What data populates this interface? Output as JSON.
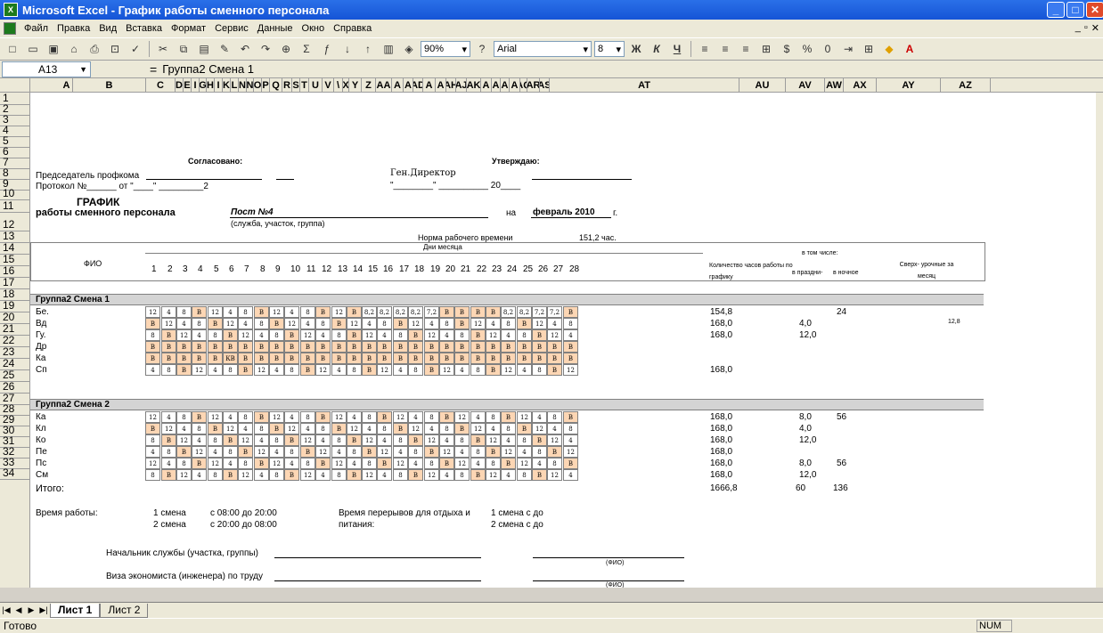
{
  "window": {
    "title": "Microsoft Excel - График работы сменного персонала"
  },
  "menu": [
    "Файл",
    "Правка",
    "Вид",
    "Вставка",
    "Формат",
    "Сервис",
    "Данные",
    "Окно",
    "Справка"
  ],
  "toolbar": {
    "zoom": "90%",
    "font": "Arial",
    "size": "8",
    "bold": "Ж",
    "italic": "К",
    "underline": "Ч"
  },
  "formula": {
    "cell": "A13",
    "content": "Группа2 Смена 1"
  },
  "columns": [
    "A",
    "B",
    "C",
    "D",
    "E",
    "I",
    "G",
    "H",
    "I",
    "K",
    "L",
    "N",
    "N",
    "O",
    "P",
    "Q",
    "R",
    "S",
    "T",
    "U",
    "V",
    "\\",
    "X",
    "Y",
    "Z",
    "AA",
    "A",
    "A",
    "AD",
    "A",
    "A",
    "AH",
    "AJ",
    "AK",
    "A",
    "A",
    "A",
    "A",
    "AQ",
    "AR",
    "AS",
    "AT",
    "AU",
    "AV",
    "AW",
    "AX",
    "AY",
    "AZ"
  ],
  "header": {
    "agreed": "Согласовано:",
    "approve": "Утверждаю:",
    "chairman": "Председатель профкома",
    "director": "Ген.Директор",
    "protocol": "Протокол №______ от \"____\" _________2",
    "date_line": "\"________\" __________ 20____",
    "title": "ГРАФИК",
    "subtitle": "работы  сменного персонала",
    "post": "Пост №4",
    "on": "на",
    "month": "февраль 2010",
    "g": "г.",
    "service": "(служба, участок, группа)",
    "norm_label": "Норма рабочего времени",
    "norm_value": "151,2 час."
  },
  "table": {
    "fio": "ФИО",
    "days_label": "Дни месяца",
    "days": [
      "1",
      "2",
      "3",
      "4",
      "5",
      "6",
      "7",
      "8",
      "9",
      "10",
      "11",
      "12",
      "13",
      "14",
      "15",
      "16",
      "17",
      "18",
      "19",
      "20",
      "21",
      "22",
      "23",
      "24",
      "25",
      "26",
      "27",
      "28"
    ],
    "hours_label": "Количество часов работы по графику",
    "incl_label": "в том числе:",
    "holiday": "в праздни-",
    "night": "в ночное",
    "overtime": "Сверх- урочные за месяц"
  },
  "groups": [
    "Группа2 Смена 1",
    "Группа2 Смена 2"
  ],
  "rows": [
    {
      "n": "14",
      "name": "Бе.",
      "d": [
        "12",
        "4",
        "8",
        "В",
        "12",
        "4",
        "8",
        "В",
        "12",
        "4",
        "8",
        "В",
        "12",
        "В",
        "8,2",
        "8,2",
        "8,2",
        "8,2",
        "7,2",
        "В",
        "В",
        "В",
        "В",
        "8,2",
        "8,2",
        "7,2",
        "7,2",
        "В"
      ],
      "h": "154,8",
      "hol": "",
      "night": "24",
      "ot": ""
    },
    {
      "n": "15",
      "name": "Вд",
      "d": [
        "В",
        "12",
        "4",
        "8",
        "В",
        "12",
        "4",
        "8",
        "В",
        "12",
        "4",
        "8",
        "В",
        "12",
        "4",
        "8",
        "В",
        "12",
        "4",
        "8",
        "В",
        "12",
        "4",
        "8",
        "В",
        "12",
        "4",
        "8"
      ],
      "h": "168,0",
      "hol": "4,0",
      "night": "",
      "ot": "12,8"
    },
    {
      "n": "16",
      "name": "Гу.",
      "d": [
        "8",
        "В",
        "12",
        "4",
        "8",
        "В",
        "12",
        "4",
        "8",
        "В",
        "12",
        "4",
        "8",
        "В",
        "12",
        "4",
        "8",
        "В",
        "12",
        "4",
        "8",
        "В",
        "12",
        "4",
        "8",
        "В",
        "12",
        "4"
      ],
      "h": "168,0",
      "hol": "12,0",
      "night": "",
      "ot": ""
    },
    {
      "n": "17",
      "name": "Др",
      "d": [
        "В",
        "В",
        "В",
        "В",
        "В",
        "В",
        "В",
        "В",
        "В",
        "В",
        "В",
        "В",
        "В",
        "В",
        "В",
        "В",
        "В",
        "В",
        "В",
        "В",
        "В",
        "В",
        "В",
        "В",
        "В",
        "В",
        "В",
        "В"
      ],
      "h": "",
      "hol": "",
      "night": "",
      "ot": ""
    },
    {
      "n": "18",
      "name": "Ка",
      "d": [
        "В",
        "В",
        "В",
        "В",
        "В",
        "КВ",
        "В",
        "В",
        "В",
        "В",
        "В",
        "В",
        "В",
        "В",
        "В",
        "В",
        "В",
        "В",
        "В",
        "В",
        "В",
        "В",
        "В",
        "В",
        "В",
        "В",
        "В",
        "В"
      ],
      "h": "",
      "hol": "",
      "night": "",
      "ot": ""
    },
    {
      "n": "19",
      "name": "Сп",
      "d": [
        "4",
        "8",
        "В",
        "12",
        "4",
        "8",
        "В",
        "12",
        "4",
        "8",
        "В",
        "12",
        "4",
        "8",
        "В",
        "12",
        "4",
        "8",
        "В",
        "12",
        "4",
        "8",
        "В",
        "12",
        "4",
        "8",
        "В",
        "12"
      ],
      "h": "168,0",
      "hol": "",
      "night": "",
      "ot": ""
    },
    {
      "n": "21",
      "name": "Ка",
      "d": [
        "12",
        "4",
        "8",
        "В",
        "12",
        "4",
        "8",
        "В",
        "12",
        "4",
        "8",
        "В",
        "12",
        "4",
        "8",
        "В",
        "12",
        "4",
        "8",
        "В",
        "12",
        "4",
        "8",
        "В",
        "12",
        "4",
        "8",
        "В"
      ],
      "h": "168,0",
      "hol": "8,0",
      "night": "56",
      "ot": ""
    },
    {
      "n": "22",
      "name": "Кл",
      "d": [
        "В",
        "12",
        "4",
        "8",
        "В",
        "12",
        "4",
        "8",
        "В",
        "12",
        "4",
        "8",
        "В",
        "12",
        "4",
        "8",
        "В",
        "12",
        "4",
        "8",
        "В",
        "12",
        "4",
        "8",
        "В",
        "12",
        "4",
        "8"
      ],
      "h": "168,0",
      "hol": "4,0",
      "night": "",
      "ot": ""
    },
    {
      "n": "23",
      "name": "Ко",
      "d": [
        "8",
        "В",
        "12",
        "4",
        "8",
        "В",
        "12",
        "4",
        "8",
        "В",
        "12",
        "4",
        "8",
        "В",
        "12",
        "4",
        "8",
        "В",
        "12",
        "4",
        "8",
        "В",
        "12",
        "4",
        "8",
        "В",
        "12",
        "4"
      ],
      "h": "168,0",
      "hol": "12,0",
      "night": "",
      "ot": ""
    },
    {
      "n": "24",
      "name": "Пе",
      "d": [
        "4",
        "8",
        "В",
        "12",
        "4",
        "8",
        "В",
        "12",
        "4",
        "8",
        "В",
        "12",
        "4",
        "8",
        "В",
        "12",
        "4",
        "8",
        "В",
        "12",
        "4",
        "8",
        "В",
        "12",
        "4",
        "8",
        "В",
        "12"
      ],
      "h": "168,0",
      "hol": "",
      "night": "",
      "ot": ""
    },
    {
      "n": "25",
      "name": "Пс",
      "d": [
        "12",
        "4",
        "8",
        "В",
        "12",
        "4",
        "8",
        "В",
        "12",
        "4",
        "8",
        "В",
        "12",
        "4",
        "8",
        "В",
        "12",
        "4",
        "8",
        "В",
        "12",
        "4",
        "8",
        "В",
        "12",
        "4",
        "8",
        "В"
      ],
      "h": "168,0",
      "hol": "8,0",
      "night": "56",
      "ot": ""
    },
    {
      "n": "26",
      "name": "См",
      "d": [
        "8",
        "В",
        "12",
        "4",
        "8",
        "В",
        "12",
        "4",
        "8",
        "В",
        "12",
        "4",
        "8",
        "В",
        "12",
        "4",
        "8",
        "В",
        "12",
        "4",
        "8",
        "В",
        "12",
        "4",
        "8",
        "В",
        "12",
        "4"
      ],
      "h": "168,0",
      "hol": "12,0",
      "night": "",
      "ot": ""
    }
  ],
  "total": {
    "label": "Итого:",
    "h": "1666,8",
    "hol": "60",
    "night": "136"
  },
  "footer": {
    "work_time": "Время работы:",
    "shift1": "1  смена",
    "shift2": "2  смена",
    "time1": "с 08:00 до 20:00",
    "time2": "с 20:00 до 08:00",
    "break_label": "Время перерывов для отдыха и",
    "meal": "питания:",
    "s1": "1  смена   с  до",
    "s2": "2  смена   с  до",
    "chief": "Начальник службы (участка,  группы)",
    "visa": "Виза экономиста (инженера) по труду",
    "fio1": "(ФИО)",
    "fio2": "(ФИО)"
  },
  "tabs": [
    "Лист 1",
    "Лист 2"
  ],
  "status": {
    "ready": "Готово",
    "num": "NUM"
  },
  "colors": {
    "titlebar": "#1554d6",
    "dayoff": "#fcd6b4",
    "group": "#d4d4d4"
  }
}
